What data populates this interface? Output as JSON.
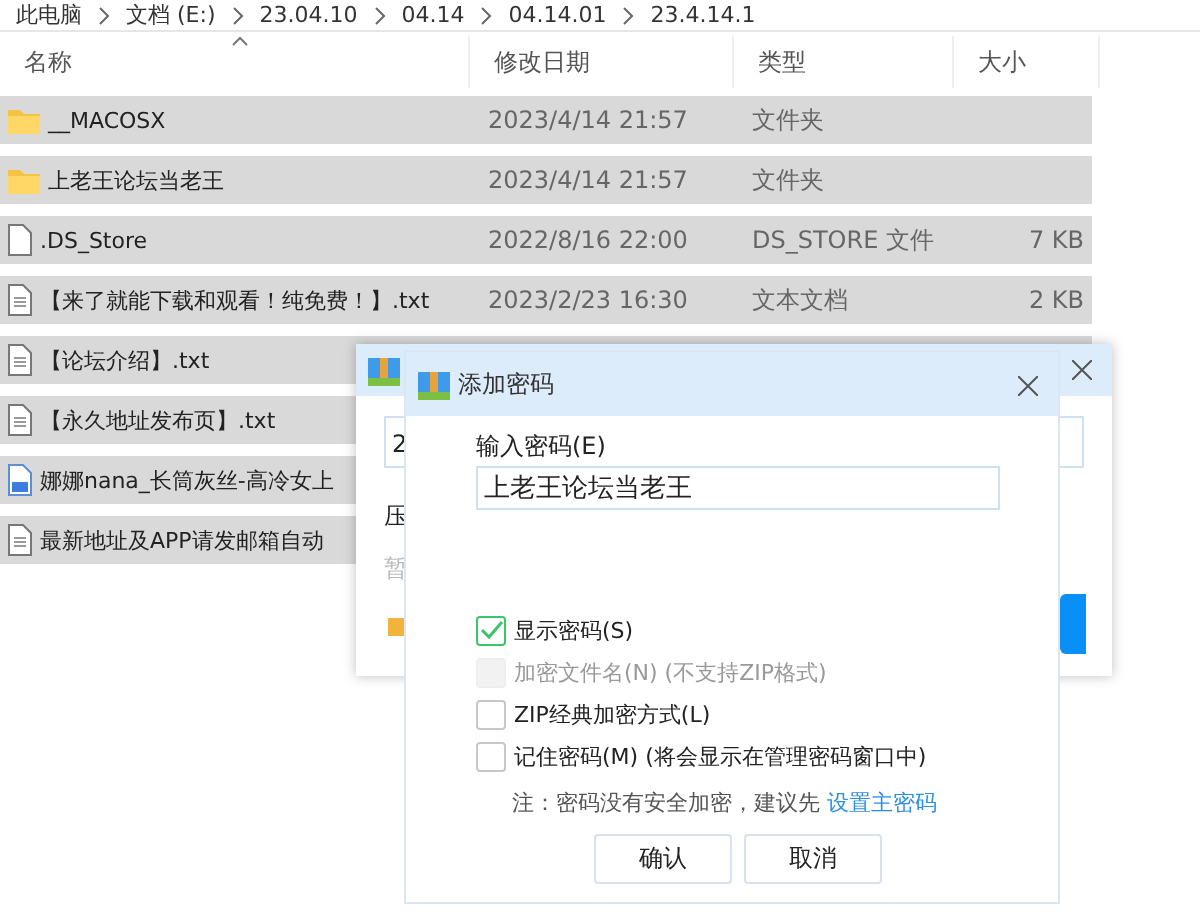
{
  "breadcrumb": [
    "此电脑",
    "文档 (E:)",
    "23.04.10",
    "04.14",
    "04.14.01",
    "23.4.14.1"
  ],
  "columns": [
    "名称",
    "修改日期",
    "类型",
    "大小"
  ],
  "files": [
    {
      "kind": "folder",
      "name": "__MACOSX",
      "date": "2023/4/14 21:57",
      "type": "文件夹",
      "selected": true
    },
    {
      "kind": "folder",
      "name": "上老王论坛当老王",
      "date": "2023/4/14 21:57",
      "type": "文件夹",
      "selected": true
    },
    {
      "kind": "file",
      "name": ".DS_Store",
      "date": "2022/8/16 22:00",
      "type": "DS_STORE 文件",
      "size": "7 KB",
      "selected": true
    },
    {
      "kind": "text",
      "name": "【来了就能下载和观看！纯免费！】.txt",
      "date": "2023/2/23 16:30",
      "type": "文本文档",
      "size": "2 KB",
      "selected": true
    },
    {
      "kind": "text",
      "name": "【论坛介绍】.txt",
      "selected": true
    },
    {
      "kind": "text",
      "name": "【永久地址发布页】.txt",
      "selected": true
    },
    {
      "kind": "image",
      "name": "娜娜nana_长筒灰丝-高冷女上",
      "selected": true
    },
    {
      "kind": "text",
      "name": "最新地址及APP请发邮箱自动",
      "selected": true
    }
  ],
  "back_dialog": {
    "field_value": "2",
    "label": "压",
    "hint": "暂"
  },
  "password_dialog": {
    "title": "添加密码",
    "field_label": "输入密码(E)",
    "password": "上老王论坛当老王",
    "options": [
      {
        "label": "显示密码(S)",
        "checked": true,
        "disabled": false
      },
      {
        "label": "加密文件名(N) (不支持ZIP格式)",
        "checked": false,
        "disabled": true
      },
      {
        "label": "ZIP经典加密方式(L)",
        "checked": false,
        "disabled": false
      },
      {
        "label": "记住密码(M) (将会显示在管理密码窗口中)",
        "checked": false,
        "disabled": false
      }
    ],
    "note": "注：密码没有安全加密，建议先",
    "note_link": "设置主密码",
    "buttons": [
      "确认",
      "取消"
    ]
  }
}
